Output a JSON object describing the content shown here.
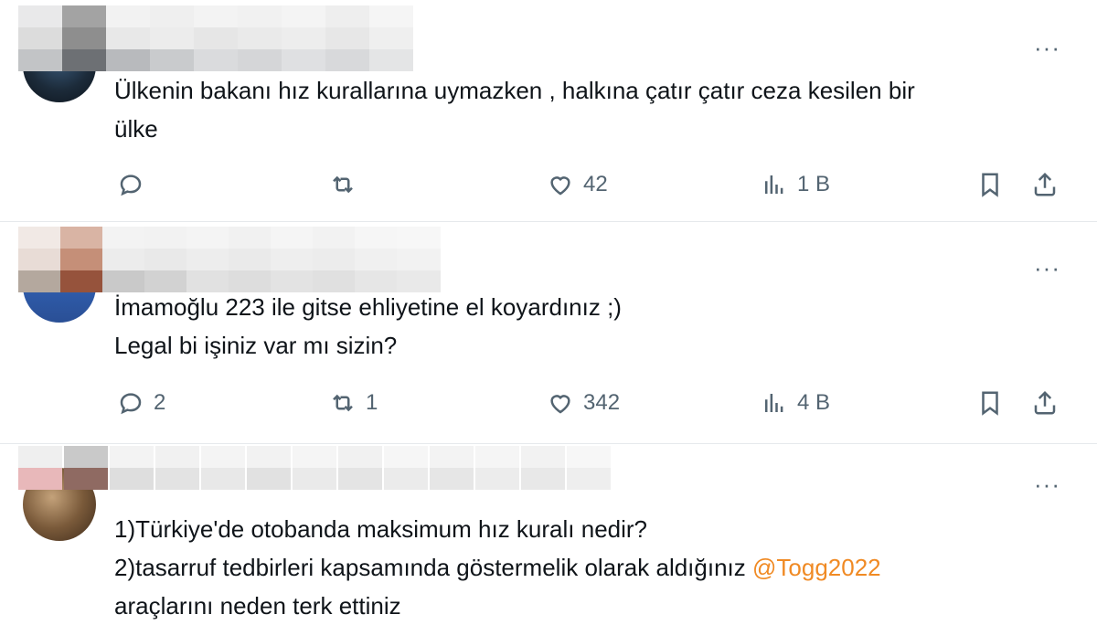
{
  "tweets": [
    {
      "text_lines": [
        "Ülkenin bakanı hız kurallarına uymazken , halkına çatır çatır ceza kesilen bir",
        "ülke"
      ],
      "actions": {
        "reply": "",
        "retweet": "",
        "like": "42",
        "views": "1 B"
      }
    },
    {
      "text_lines": [
        "İmamoğlu 223 ile gitse ehliyetine el koyardınız ;)",
        "Legal bi işiniz var mı sizin?"
      ],
      "actions": {
        "reply": "2",
        "retweet": "1",
        "like": "342",
        "views": "4 B"
      }
    },
    {
      "text_lines": [
        "1)Türkiye'de  otobanda maksimum hız kuralı nedir?",
        "2)tasarruf tedbirleri kapsamında göstermelik olarak aldığınız ",
        "araçlarını neden terk ettiniz"
      ],
      "mention": "@Togg2022",
      "actions": {
        "reply": "",
        "retweet": "",
        "like": "",
        "views": ""
      }
    }
  ],
  "more_glyph": "···",
  "colors": {
    "text": "#0f1419",
    "secondary": "#536471",
    "mention": "#f08a24",
    "divider": "#e6e9ec"
  },
  "icons": [
    "reply-icon",
    "retweet-icon",
    "like-icon",
    "views-icon",
    "bookmark-icon",
    "share-icon",
    "more-icon"
  ]
}
